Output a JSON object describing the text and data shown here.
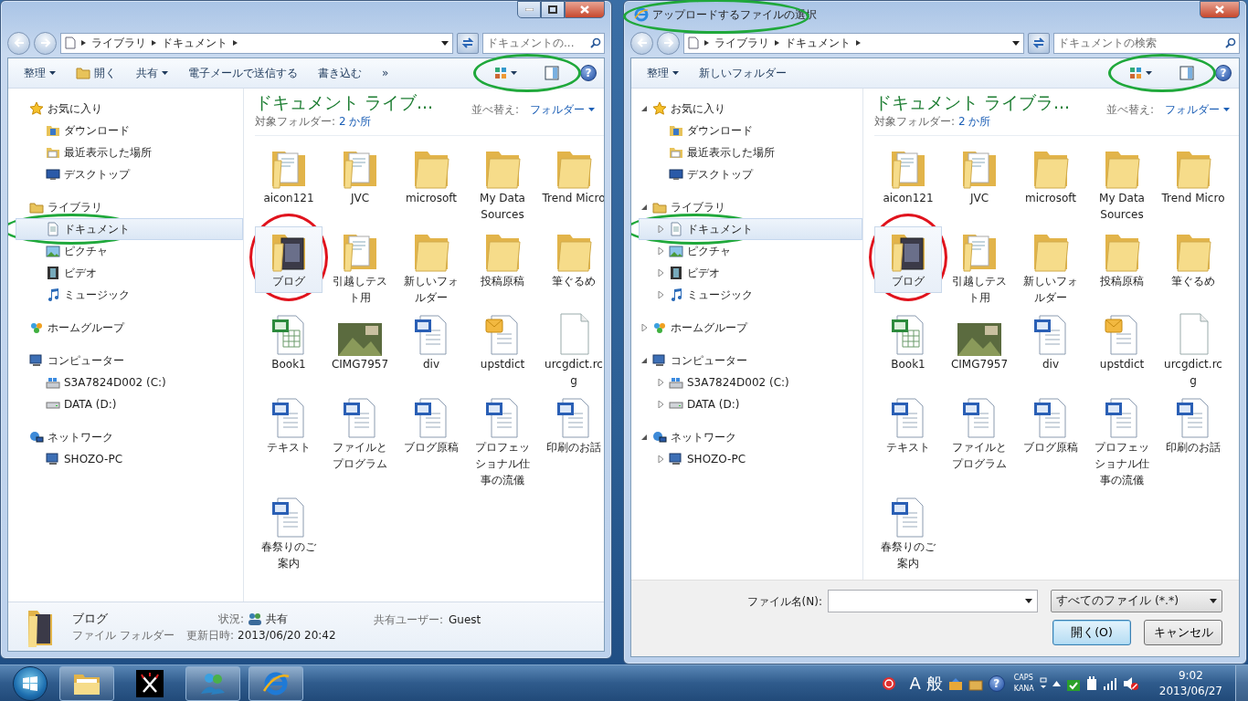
{
  "explorer": {
    "breadcrumb": [
      "ライブラリ",
      "ドキュメント"
    ],
    "search_placeholder": "ドキュメントの...",
    "toolbar": [
      {
        "label": "整理",
        "kind": "menu"
      },
      {
        "label": "開く",
        "kind": "open"
      },
      {
        "label": "共有",
        "kind": "menu"
      },
      {
        "label": "電子メールで送信する",
        "kind": "plain"
      },
      {
        "label": "書き込む",
        "kind": "plain"
      },
      {
        "label": "»",
        "kind": "plain"
      }
    ],
    "view_controls": {
      "circled": true
    },
    "help": "?",
    "nav": [
      {
        "label": "お気に入り",
        "selected": false,
        "children": [
          {
            "label": "ダウンロード",
            "selected": false
          },
          {
            "label": "最近表示した場所",
            "selected": false
          },
          {
            "label": "デスクトップ",
            "selected": false
          }
        ]
      },
      {
        "label": "ライブラリ",
        "selected": false,
        "children": [
          {
            "label": "ドキュメント",
            "selected": true,
            "circled": true
          },
          {
            "label": "ピクチャ",
            "selected": false
          },
          {
            "label": "ビデオ",
            "selected": false
          },
          {
            "label": "ミュージック",
            "selected": false
          }
        ]
      },
      {
        "label": "ホームグループ",
        "selected": false
      },
      {
        "label": "コンピューター",
        "selected": false,
        "children": [
          {
            "label": "S3A7824D002 (C:)",
            "selected": false
          },
          {
            "label": "DATA (D:)",
            "selected": false
          }
        ]
      },
      {
        "label": "ネットワーク",
        "selected": false,
        "children": [
          {
            "label": "SHOZO-PC",
            "selected": false
          }
        ]
      }
    ],
    "library": {
      "title": "ドキュメント ライブ...",
      "folders_label": "対象フォルダー:",
      "folders_link": "2 か所",
      "sort_label": "並べ替え:",
      "sort_value": "フォルダー"
    },
    "files": [
      {
        "name": "aicon121",
        "kind": "folder-docs",
        "selected": false
      },
      {
        "name": "JVC",
        "kind": "folder-docs",
        "selected": false
      },
      {
        "name": "microsoft",
        "kind": "folder",
        "selected": false
      },
      {
        "name": "My Data Sources",
        "kind": "folder",
        "selected": false
      },
      {
        "name": "Trend Micro",
        "kind": "folder",
        "selected": false
      },
      {
        "name": "ブログ",
        "kind": "folder-photo",
        "selected": true,
        "circled": true
      },
      {
        "name": "引越しテスト用",
        "kind": "folder-docs",
        "selected": false
      },
      {
        "name": "新しいフォルダー",
        "kind": "folder",
        "selected": false
      },
      {
        "name": "投稿原稿",
        "kind": "folder",
        "selected": false
      },
      {
        "name": "筆ぐるめ",
        "kind": "folder",
        "selected": false
      },
      {
        "name": "Book1",
        "kind": "spreadsheet",
        "selected": false
      },
      {
        "name": "CIMG7957",
        "kind": "photo",
        "selected": false
      },
      {
        "name": "div",
        "kind": "word",
        "selected": false
      },
      {
        "name": "upstdict",
        "kind": "notes",
        "selected": false
      },
      {
        "name": "urcgdict.rcg",
        "kind": "blank",
        "selected": false
      },
      {
        "name": "テキスト",
        "kind": "word",
        "selected": false
      },
      {
        "name": "ファイルとプログラム",
        "kind": "word",
        "selected": false
      },
      {
        "name": "ブログ原稿",
        "kind": "word",
        "selected": false
      },
      {
        "name": "プロフェッショナル仕事の流儀",
        "kind": "word",
        "selected": false
      },
      {
        "name": "印刷のお話",
        "kind": "word",
        "selected": false
      },
      {
        "name": "春祭りのご案内",
        "kind": "word",
        "selected": false
      }
    ],
    "details": {
      "name": "ブログ",
      "type": "ファイル フォルダー",
      "status_label": "状況:",
      "status": "共有",
      "date_label": "更新日時:",
      "date": "2013/06/20 20:42",
      "shared_label": "共有ユーザー:",
      "shared": "Guest"
    }
  },
  "dialog": {
    "title": "アップロードするファイルの選択",
    "title_circled": true,
    "breadcrumb": [
      "ライブラリ",
      "ドキュメント"
    ],
    "search_placeholder": "ドキュメントの検索",
    "toolbar": [
      {
        "label": "整理",
        "kind": "menu"
      },
      {
        "label": "新しいフォルダー",
        "kind": "plain"
      }
    ],
    "view_controls": {
      "circled": true
    },
    "help": "?",
    "nav": [
      {
        "label": "お気に入り",
        "selected": false,
        "expanded": true,
        "children": [
          {
            "label": "ダウンロード",
            "selected": false
          },
          {
            "label": "最近表示した場所",
            "selected": false
          },
          {
            "label": "デスクトップ",
            "selected": false
          }
        ]
      },
      {
        "label": "ライブラリ",
        "selected": false,
        "expanded": true,
        "children": [
          {
            "label": "ドキュメント",
            "selected": true,
            "circled": true,
            "expanded": false
          },
          {
            "label": "ピクチャ",
            "selected": false,
            "expanded": false
          },
          {
            "label": "ビデオ",
            "selected": false,
            "expanded": false
          },
          {
            "label": "ミュージック",
            "selected": false,
            "expanded": false
          }
        ]
      },
      {
        "label": "ホームグループ",
        "selected": false,
        "expanded": false
      },
      {
        "label": "コンピューター",
        "selected": false,
        "expanded": true,
        "children": [
          {
            "label": "S3A7824D002 (C:)",
            "selected": false,
            "expanded": false
          },
          {
            "label": "DATA (D:)",
            "selected": false,
            "expanded": false
          }
        ]
      },
      {
        "label": "ネットワーク",
        "selected": false,
        "expanded": true,
        "children": [
          {
            "label": "SHOZO-PC",
            "selected": false,
            "expanded": false
          }
        ]
      }
    ],
    "library": {
      "title": "ドキュメント ライブラ...",
      "folders_label": "対象フォルダー:",
      "folders_link": "2 か所",
      "sort_label": "並べ替え:",
      "sort_value": "フォルダー"
    },
    "files": [
      {
        "name": "aicon121",
        "kind": "folder-docs",
        "selected": false
      },
      {
        "name": "JVC",
        "kind": "folder-docs",
        "selected": false
      },
      {
        "name": "microsoft",
        "kind": "folder",
        "selected": false
      },
      {
        "name": "My Data Sources",
        "kind": "folder",
        "selected": false
      },
      {
        "name": "Trend Micro",
        "kind": "folder",
        "selected": false
      },
      {
        "name": "ブログ",
        "kind": "folder-photo",
        "selected": true,
        "circled": true
      },
      {
        "name": "引越しテスト用",
        "kind": "folder-docs",
        "selected": false
      },
      {
        "name": "新しいフォルダー",
        "kind": "folder",
        "selected": false
      },
      {
        "name": "投稿原稿",
        "kind": "folder",
        "selected": false
      },
      {
        "name": "筆ぐるめ",
        "kind": "folder",
        "selected": false
      },
      {
        "name": "Book1",
        "kind": "spreadsheet",
        "selected": false
      },
      {
        "name": "CIMG7957",
        "kind": "photo",
        "selected": false
      },
      {
        "name": "div",
        "kind": "word",
        "selected": false
      },
      {
        "name": "upstdict",
        "kind": "notes",
        "selected": false
      },
      {
        "name": "urcgdict.rcg",
        "kind": "blank",
        "selected": false
      },
      {
        "name": "テキスト",
        "kind": "word",
        "selected": false
      },
      {
        "name": "ファイルとプログラム",
        "kind": "word",
        "selected": false
      },
      {
        "name": "ブログ原稿",
        "kind": "word",
        "selected": false
      },
      {
        "name": "プロフェッショナル仕事の流儀",
        "kind": "word",
        "selected": false
      },
      {
        "name": "印刷のお話",
        "kind": "word",
        "selected": false
      },
      {
        "name": "春祭りのご案内",
        "kind": "word",
        "selected": false
      }
    ],
    "filename_label": "ファイル名(N):",
    "filter": "すべてのファイル (*.*)",
    "buttons": [
      {
        "label": "開く(O)",
        "kind": "default"
      },
      {
        "label": "キャンセル",
        "kind": "normal"
      }
    ]
  },
  "taskbar": {
    "ime_mode": "A",
    "ime_kanji": "般",
    "help": "?",
    "caps": "CAPS",
    "kana": "KANA",
    "time": "9:02",
    "date": "2013/06/27"
  }
}
